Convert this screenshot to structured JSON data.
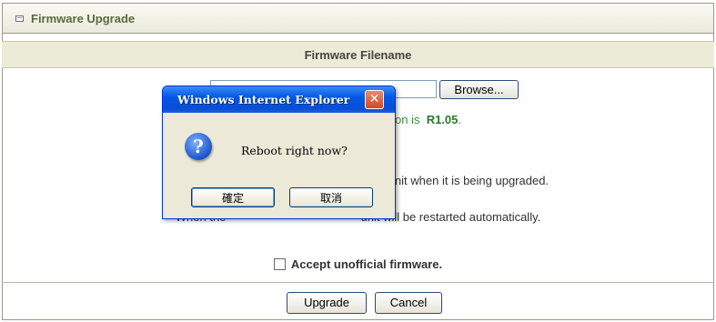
{
  "section": {
    "title": "Firmware Upgrade",
    "column_header": "Firmware Filename"
  },
  "file_picker": {
    "value": "",
    "browse_label": "Browse..."
  },
  "version": {
    "prefix": "on is",
    "value": "R1.05",
    "suffix": "."
  },
  "notes": {
    "line1_visible": "Note! Do n                                          f the unit when it is being upgraded.",
    "line2_visible": "When the                                         unit will be restarted automatically."
  },
  "accept": {
    "label": "Accept unofficial firmware.",
    "checked": false
  },
  "actions": {
    "upgrade_label": "Upgrade",
    "cancel_label": "Cancel"
  },
  "dialog": {
    "title": "Windows Internet Explorer",
    "close_glyph": "✕",
    "icon": "question-icon",
    "message": "Reboot right now?",
    "ok_label": "確定",
    "cancel_label": "取消"
  },
  "colors": {
    "title_text": "#5a6a3a",
    "version_green": "#2a7a2a",
    "dialog_title": "#0058e6"
  }
}
